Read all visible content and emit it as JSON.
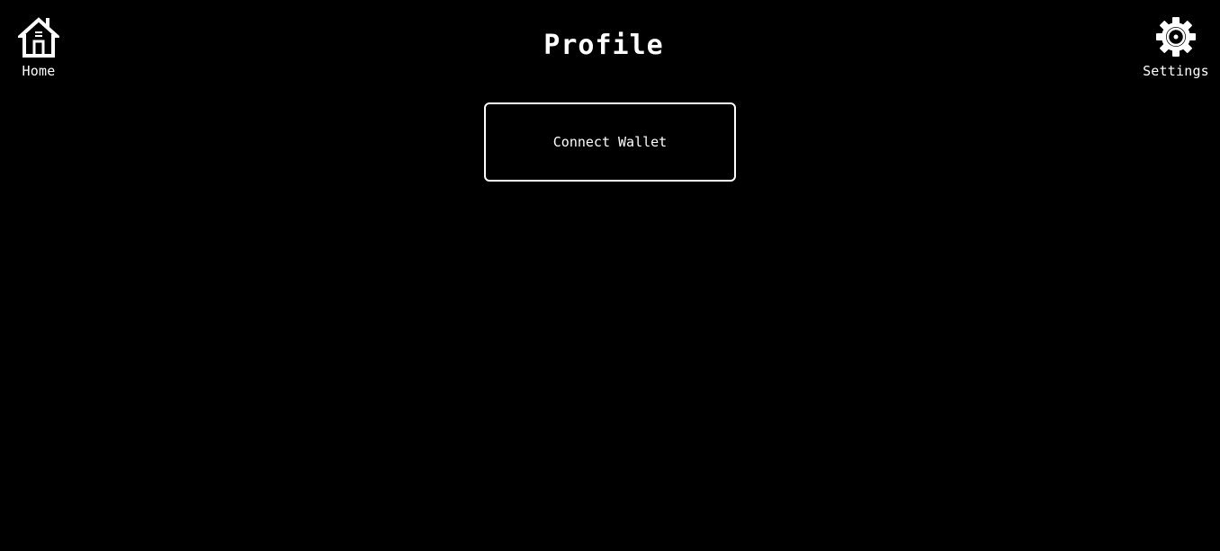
{
  "header": {
    "title": "Profile",
    "home": {
      "label": "Home",
      "icon": "home-icon"
    },
    "settings": {
      "label": "Settings",
      "icon": "gear-icon"
    }
  },
  "main": {
    "connect_wallet_label": "Connect Wallet"
  },
  "colors": {
    "background": "#000000",
    "foreground": "#ffffff"
  }
}
